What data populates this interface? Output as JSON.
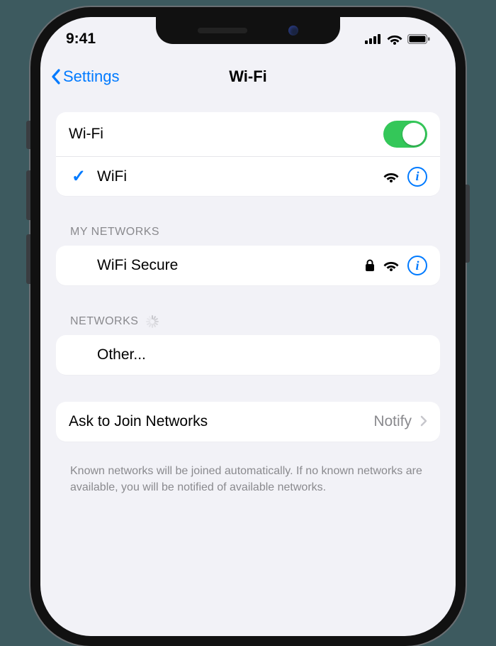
{
  "status": {
    "time": "9:41"
  },
  "nav": {
    "back_label": "Settings",
    "title": "Wi-Fi"
  },
  "wifi_toggle": {
    "label": "Wi-Fi",
    "on": true
  },
  "connected": {
    "name": "WiFi",
    "secure": false
  },
  "sections": {
    "my_networks_header": "MY NETWORKS",
    "networks_header": "NETWORKS"
  },
  "my_networks": [
    {
      "name": "WiFi Secure",
      "secure": true
    }
  ],
  "other_label": "Other...",
  "ask_join": {
    "label": "Ask to Join Networks",
    "value": "Notify"
  },
  "footer": "Known networks will be joined automatically. If no known networks are available, you will be notified of available networks."
}
